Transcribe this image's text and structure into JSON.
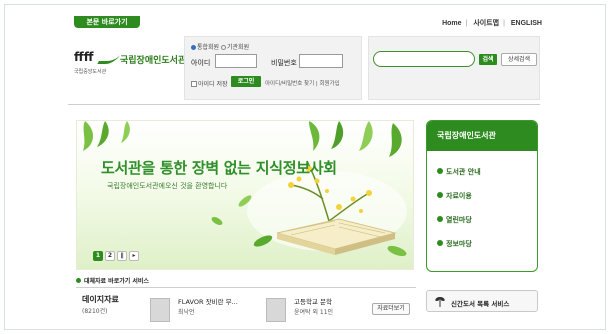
{
  "top": {
    "shortcut_tab": "본문 바로가기",
    "links": [
      "Home",
      "사이트맵",
      "ENGLISH"
    ]
  },
  "logo": {
    "title": "국립장애인도서관",
    "sub": "국립중앙도서관"
  },
  "login": {
    "radio_member": "통합회원",
    "radio_org": "기관회원",
    "id_label": "아이디",
    "pw_label": "비밀번호",
    "remember_label": "아이디 저장",
    "login_button": "로그인",
    "find_links": "아이디/비밀번호 찾기 | 회원가입"
  },
  "search": {
    "placeholder": "",
    "search_button": "검색",
    "advanced_button": "상세검색"
  },
  "banner": {
    "title": "도서관을 통한 장벽 없는 지식정보사회",
    "subtitle": "국립장애인도서관에오신 것을 환영합니다",
    "pages": [
      "1",
      "2"
    ],
    "active_page": "1"
  },
  "side_nav": {
    "heading": "국립장애인도서관",
    "items": [
      "도서관 안내",
      "자료이용",
      "열린마당",
      "정보마당"
    ]
  },
  "service_line": "대체자료 바로가기 서비스",
  "daisy": {
    "title": "데이지자료",
    "count": "(8210건)"
  },
  "books": [
    {
      "title": "FLAVOR 잣비란 무...",
      "author": "최낙언"
    },
    {
      "title": "고등학교 문학",
      "author": "윤여탁 외 11인"
    }
  ],
  "more_button": "자료더보기",
  "new_books_label": "신간도서 목록 서비스",
  "colors": {
    "brand_green": "#2e8b1f",
    "text_green": "#2f8f2a"
  }
}
